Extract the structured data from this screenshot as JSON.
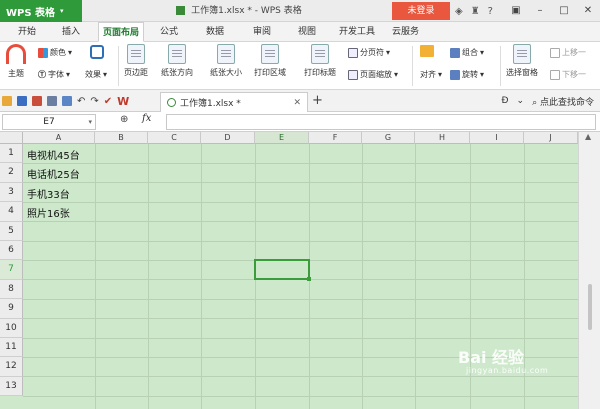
{
  "app": {
    "name": "WPS 表格"
  },
  "window": {
    "title": "工作簿1.xlsx * - WPS 表格",
    "login_label": "未登录"
  },
  "menu_tabs": [
    "开始",
    "插入",
    "页面布局",
    "公式",
    "数据",
    "审阅",
    "视图",
    "开发工具",
    "云服务"
  ],
  "active_tab": "页面布局",
  "ribbon": {
    "theme_label": "主题",
    "color_label": "颜色",
    "font_label": "字体",
    "effect_label": "效果",
    "margin_label": "页边距",
    "orientation_label": "纸张方向",
    "size_label": "纸张大小",
    "print_area_label": "打印区域",
    "print_titles_label": "打印标题",
    "page_break_label": "分页符",
    "page_zoom_label": "页面缩放",
    "align_label": "对齐",
    "group_label": "组合",
    "rotate_label": "旋转",
    "select_pane_label": "选择窗格",
    "bring_forward_label": "上移一",
    "send_backward_label": "下移一"
  },
  "doc_tab": {
    "label": "工作簿1.xlsx *"
  },
  "search": {
    "label": "点此查找命令"
  },
  "formula_bar": {
    "cell_ref": "E7",
    "fx_label": "fx",
    "value": ""
  },
  "grid": {
    "columns": [
      "A",
      "B",
      "C",
      "D",
      "E",
      "F",
      "G",
      "H",
      "I",
      "J"
    ],
    "rows": [
      "1",
      "2",
      "3",
      "4",
      "5",
      "6",
      "7",
      "8",
      "9",
      "10",
      "11",
      "12",
      "13"
    ],
    "selected_column": "E",
    "selected_row": "7",
    "cells": {
      "A1": "电视机45台",
      "A2": "电话机25台",
      "A3": "手机33台",
      "A4": "照片16张"
    }
  },
  "watermark": {
    "brand": "Bai 经验",
    "sub": "jingyan.baidu.com"
  },
  "colors": {
    "app_green": "#2f9a3a",
    "login_red": "#e9573f",
    "grid_bg": "#cde8cb",
    "selection": "#3b9c3b"
  }
}
